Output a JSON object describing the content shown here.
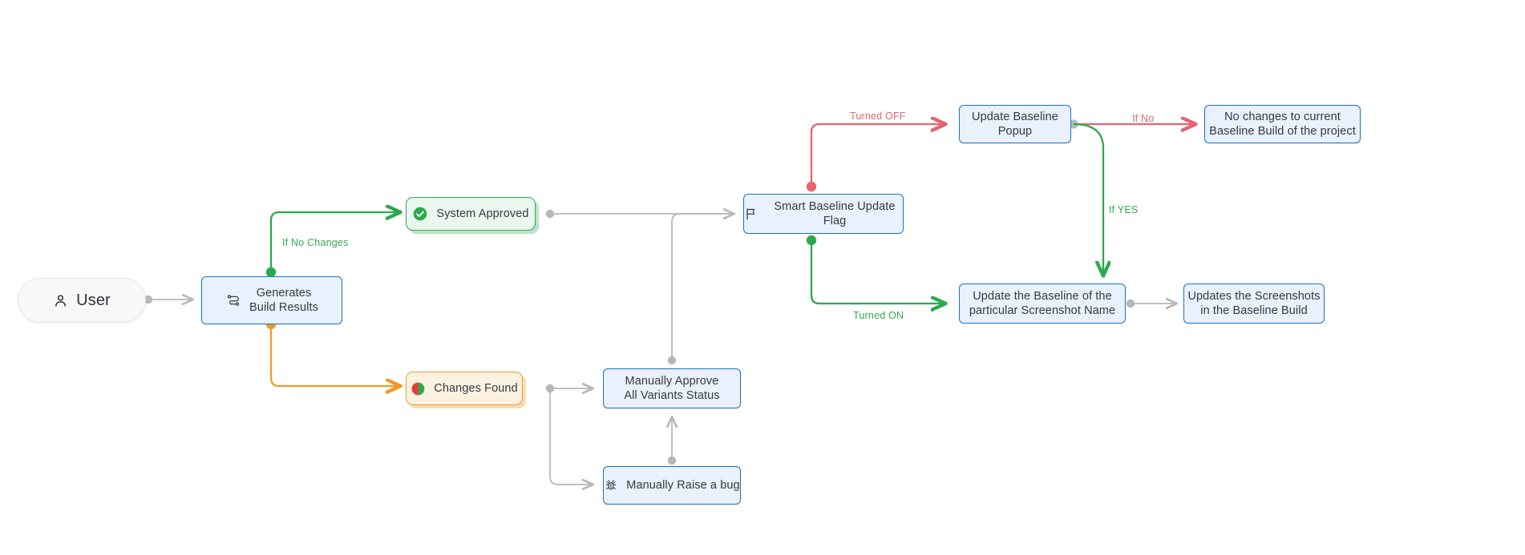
{
  "diagram": {
    "title": "Smart Baseline Update Flow",
    "colors": {
      "blue_border": "#1a73c7",
      "blue_fill": "#e8f1fc",
      "green": "#2ea84f",
      "green_label": "#34a853",
      "orange": "#f29a26",
      "red": "#e8636f",
      "gray_edge": "#b4b8bc",
      "text": "#353a40"
    },
    "nodes": [
      {
        "id": "user",
        "label": "User",
        "icon": "person-icon",
        "shape": "pill",
        "style": "user"
      },
      {
        "id": "generates-build-results",
        "label": "Generates\nBuild Results",
        "icon": "flow-icon",
        "shape": "rect",
        "style": "blue"
      },
      {
        "id": "system-approved",
        "label": "System Approved",
        "icon": "check-circle-icon",
        "shape": "rect",
        "style": "green"
      },
      {
        "id": "changes-found",
        "label": "Changes Found",
        "icon": "half-circle-diff-icon",
        "shape": "rect",
        "style": "orange"
      },
      {
        "id": "smart-baseline-update-flag",
        "label": "Smart Baseline Update Flag",
        "icon": "flag-icon",
        "shape": "rect",
        "style": "blue"
      },
      {
        "id": "manually-approve-all-variants-status",
        "label": "Manually Approve\nAll Variants Status",
        "icon": "",
        "shape": "rect",
        "style": "blue"
      },
      {
        "id": "manually-raise-a-bug",
        "label": "Manually Raise a bug",
        "icon": "bug-icon",
        "shape": "rect",
        "style": "blue"
      },
      {
        "id": "update-baseline-popup",
        "label": "Update Baseline\nPopup",
        "icon": "",
        "shape": "rect",
        "style": "blue"
      },
      {
        "id": "no-changes-to-current-baseline-build",
        "label": "No changes to current\nBaseline Build of the project",
        "icon": "",
        "shape": "rect",
        "style": "blue"
      },
      {
        "id": "update-the-baseline",
        "label": "Update the Baseline of the\nparticular Screenshot Name",
        "icon": "",
        "shape": "rect",
        "style": "blue"
      },
      {
        "id": "updates-the-screenshots",
        "label": "Updates the Screenshots\nin the Baseline Build",
        "icon": "",
        "shape": "rect",
        "style": "blue"
      }
    ],
    "edge_labels": {
      "if_no_changes": "If No Changes",
      "turned_off": "Turned OFF",
      "turned_on": "Turned ON",
      "if_no": "If No",
      "if_yes": "If YES"
    }
  }
}
